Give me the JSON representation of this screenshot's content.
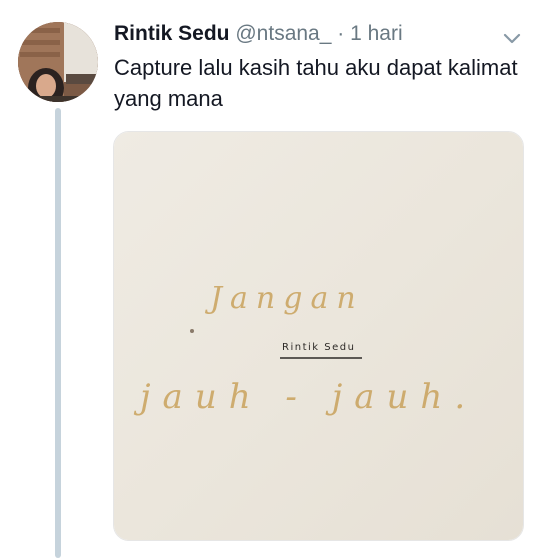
{
  "tweet": {
    "author_name": "Rintik Sedu",
    "handle": "@ntsana_",
    "separator": "·",
    "timestamp": "1 hari",
    "text": "Capture lalu kasih tahu aku dapat kalimat yang mana",
    "menu_icon": "chevron-down-icon"
  },
  "media": {
    "word_top": "Jangan",
    "signature": "Rintik Sedu",
    "word_bottom": "jauh - jauh."
  },
  "colors": {
    "name": "#141823",
    "muted": "#697882",
    "thread_line": "#c6d3dc",
    "paper": "#ece8df",
    "ink": "#c9a25c"
  }
}
